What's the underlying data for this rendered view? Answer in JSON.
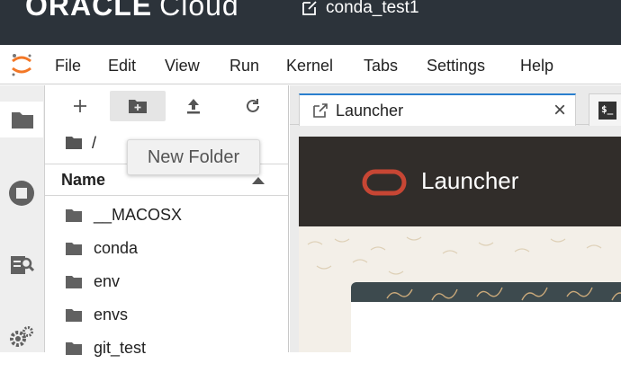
{
  "brand": {
    "name_bold": "ORACLE",
    "name_rest": "Cloud",
    "document_title": "conda_test1"
  },
  "menu": {
    "items": [
      "File",
      "Edit",
      "View",
      "Run",
      "Kernel",
      "Tabs",
      "Settings",
      "Help"
    ]
  },
  "activity_bar": {
    "icons": [
      "folder-icon",
      "running-icon",
      "property-inspector-icon",
      "extension-icon"
    ]
  },
  "file_browser": {
    "toolbar": [
      "new-launcher",
      "new-folder",
      "upload",
      "refresh"
    ],
    "breadcrumb": "/",
    "column_header": "Name",
    "tooltip": "New Folder",
    "entries": [
      "__MACOSX",
      "conda",
      "env",
      "envs",
      "git_test"
    ]
  },
  "tabs": [
    {
      "label": "Launcher",
      "close": "×"
    },
    {
      "label": "$_"
    }
  ],
  "launcher": {
    "title": "Launcher"
  },
  "colors": {
    "brand_bar": "#2c333a",
    "oracle_red": "#c74634",
    "launcher_header": "#312d2a",
    "tab_accent": "#2a7fce"
  }
}
